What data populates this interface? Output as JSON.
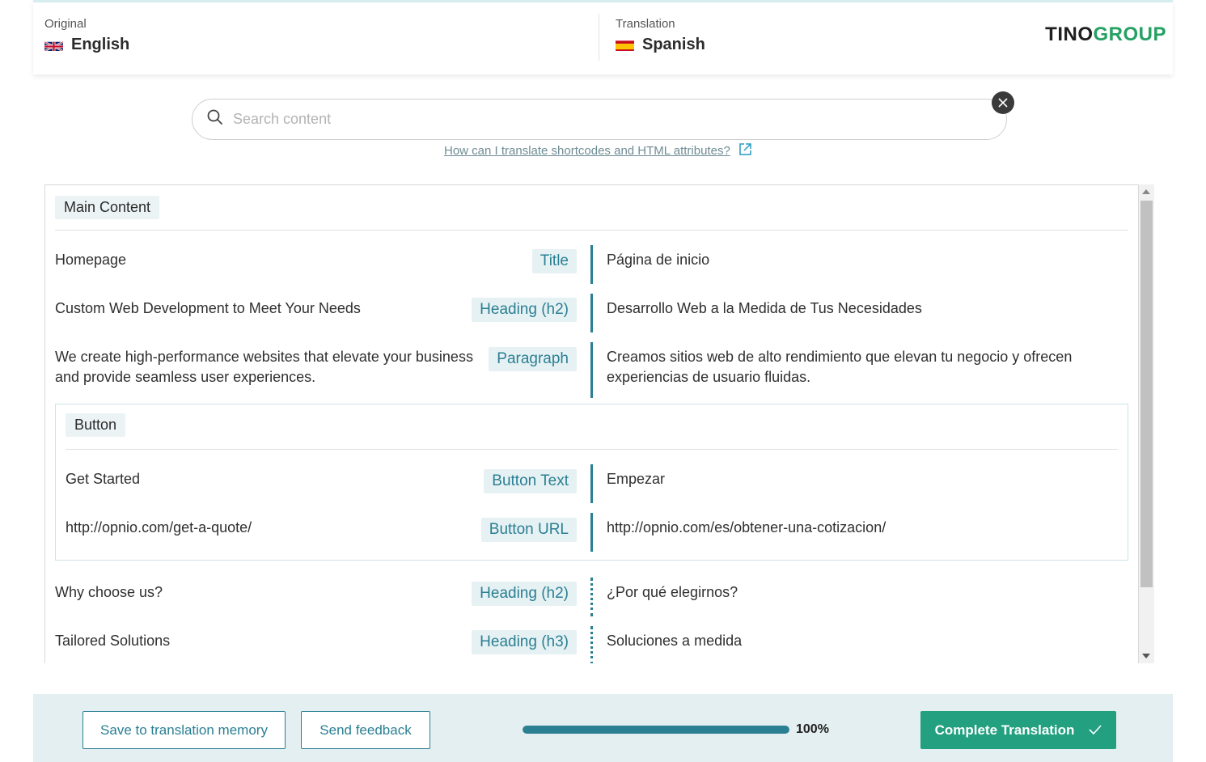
{
  "header": {
    "original_caption": "Original",
    "original_language": "English",
    "translation_caption": "Translation",
    "translation_language": "Spanish",
    "logo_part1": "TINO",
    "logo_part2": "GROUP"
  },
  "search": {
    "placeholder": "Search content",
    "help_link": "How can I translate shortcodes and HTML attributes?"
  },
  "content": {
    "main_section": "Main Content",
    "rows": [
      {
        "source": "Homepage",
        "type": "Title",
        "target": "Página de inicio"
      },
      {
        "source": "Custom Web Development to Meet Your Needs",
        "type": "Heading (h2)",
        "target": "Desarrollo Web a la Medida de Tus Necesidades"
      },
      {
        "source": "We create high-performance websites that elevate your business and provide seamless user experiences.",
        "type": "Paragraph",
        "target": "Creamos sitios web de alto rendimiento que elevan tu negocio y ofrecen experiencias de usuario fluidas."
      }
    ],
    "button_group": {
      "label": "Button",
      "rows": [
        {
          "source": "Get Started",
          "type": "Button Text",
          "target": "Empezar"
        },
        {
          "source": "http://opnio.com/get-a-quote/",
          "type": "Button URL",
          "target": "http://opnio.com/es/obtener-una-cotizacion/"
        }
      ]
    },
    "more_rows": [
      {
        "source": "Why choose us?",
        "type": "Heading (h2)",
        "target": "¿Por qué elegirnos?"
      },
      {
        "source": "Tailored Solutions",
        "type": "Heading (h3)",
        "target": "Soluciones a medida"
      }
    ]
  },
  "footer": {
    "save_memory": "Save to translation memory",
    "send_feedback": "Send feedback",
    "progress_label": "100%",
    "progress_fraction": 1.0,
    "complete": "Complete Translation"
  },
  "colors": {
    "accent": "#2a7f93",
    "primary_button": "#22a080",
    "logo_green": "#25a162"
  }
}
